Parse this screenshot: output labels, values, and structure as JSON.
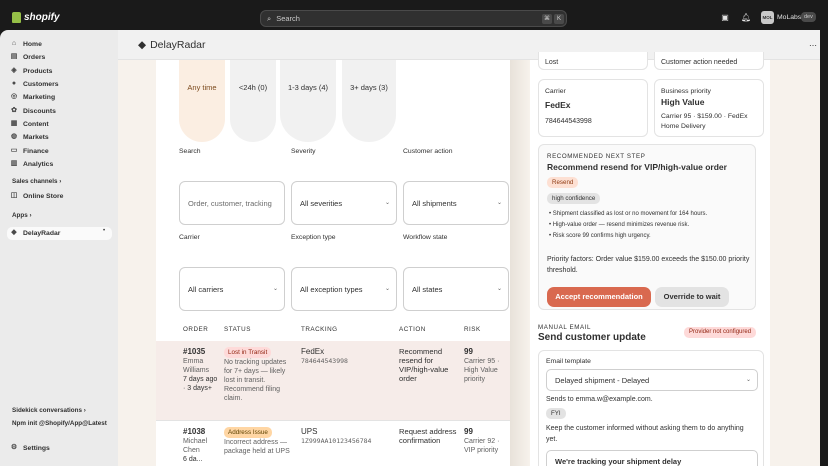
{
  "topbar": {
    "logo_text": "shopify",
    "search_placeholder": "Search",
    "shortcut_keys": [
      "⌘",
      "K"
    ],
    "store_avatar": "MOL",
    "store_name": "MoLabs",
    "store_badge": "dev"
  },
  "sidebar": {
    "items": [
      {
        "label": "Home",
        "icon": "home-icon"
      },
      {
        "label": "Orders",
        "icon": "orders-icon"
      },
      {
        "label": "Products",
        "icon": "products-icon"
      },
      {
        "label": "Customers",
        "icon": "customers-icon"
      },
      {
        "label": "Marketing",
        "icon": "marketing-icon"
      },
      {
        "label": "Discounts",
        "icon": "discounts-icon"
      },
      {
        "label": "Content",
        "icon": "content-icon"
      },
      {
        "label": "Markets",
        "icon": "markets-icon"
      },
      {
        "label": "Finance",
        "icon": "finance-icon"
      },
      {
        "label": "Analytics",
        "icon": "analytics-icon"
      }
    ],
    "sales_channels_label": "Sales channels",
    "online_store_label": "Online Store",
    "apps_label": "Apps",
    "active_app_label": "DelayRadar",
    "sidekick_label": "Sidekick conversations",
    "npm_label": "Npm init @Shopify/App@Latest",
    "settings_label": "Settings"
  },
  "app": {
    "title": "DelayRadar",
    "age_tabs": [
      "Any time",
      "<24h (0)",
      "1-3 days (4)",
      "3+ days (3)"
    ],
    "labels": {
      "search": "Search",
      "severity": "Severity",
      "customer_action": "Customer action",
      "carrier": "Carrier",
      "exception_type": "Exception type",
      "workflow_state": "Workflow state"
    },
    "fields": {
      "search_placeholder": "Order, customer, tracking",
      "severity_value": "All severities",
      "customer_action_value": "All shipments",
      "carrier_value": "All carriers",
      "exception_value": "All exception types",
      "workflow_value": "All states"
    },
    "table": {
      "headers": [
        "ORDER",
        "STATUS",
        "TRACKING",
        "ACTION",
        "RISK"
      ],
      "rows": [
        {
          "order": "#1035",
          "customer_lines": [
            "Emma",
            "Williams",
            "7 days ago",
            "· 3 days+"
          ],
          "status_badge": "Lost in Transit",
          "status_lines": [
            "No tracking updates",
            "for 7+ days — likely",
            "lost in transit.",
            "Recommend filing",
            "claim."
          ],
          "carrier": "FedEx",
          "tracking": "784644543998",
          "action_lines": [
            "Recommend",
            "resend for",
            "VIP/high-value",
            "order"
          ],
          "risk": "99",
          "risk_lines": [
            "Carrier 95 ·",
            "High Value",
            "priority"
          ]
        },
        {
          "order": "#1038",
          "customer_lines": [
            "Michael",
            "Chen",
            "6 da..."
          ],
          "status_badge": "Address Issue",
          "status_lines": [
            "Incorrect address —",
            "package held at UPS"
          ],
          "carrier": "UPS",
          "tracking": "1Z999AA10123456784",
          "action_lines": [
            "Request address",
            "confirmation"
          ],
          "risk": "99",
          "risk_lines": [
            "Carrier 92 ·",
            "VIP priority"
          ]
        }
      ]
    }
  },
  "detail": {
    "top_left": "Lost",
    "top_right": "Customer action needed",
    "carrier_label": "Carrier",
    "carrier_name": "FedEx",
    "carrier_tracking": "784644543998",
    "priority_label": "Business priority",
    "priority_value": "High Value",
    "priority_detail_1": "Carrier 95 · $159.00 · FedEx",
    "priority_detail_2": "Home Delivery",
    "rec_eyebrow": "RECOMMENDED NEXT STEP",
    "rec_title": "Recommend resend for VIP/high-value order",
    "rec_tag": "Resend",
    "rec_confidence": "high confidence",
    "rec_bullets": [
      "Shipment classified as lost or no movement for 164 hours.",
      "High-value order — resend minimizes revenue risk.",
      "Risk score 99 confirms high urgency."
    ],
    "priority_factors_1": "Priority factors: Order value $159.00 exceeds the $150.00 priority",
    "priority_factors_2": "threshold.",
    "accept_button": "Accept recommendation",
    "override_button": "Override to wait",
    "email_eyebrow": "MANUAL EMAIL",
    "email_title": "Send customer update",
    "provider_badge": "Provider not configured",
    "template_label": "Email template",
    "template_value": "Delayed shipment - Delayed",
    "sends_to": "Sends to emma.w@example.com.",
    "fyi_tag": "FYI",
    "fyi_text_1": "Keep the customer informed without asking them to do anything",
    "fyi_text_2": "yet.",
    "bottom_field": "We're tracking your shipment delay"
  },
  "colors": {
    "accent": "#d9694f",
    "highlight_row": "#f6ece9",
    "lost_badge": "#fedad9",
    "address_badge": "#ffd6a4",
    "resend_tag": "#fde0d3",
    "provider_badge": "#fedad9"
  }
}
